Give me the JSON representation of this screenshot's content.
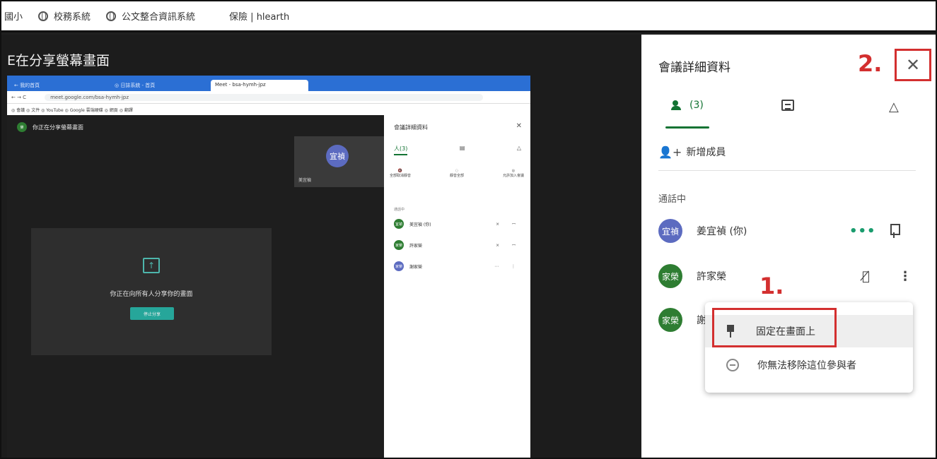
{
  "bookmarks": [
    "國小",
    "校務系統",
    "公文整合資訊系統",
    "保險 | hlearth"
  ],
  "stage": {
    "title": "E在分享螢幕畫面"
  },
  "nested": {
    "tabs": [
      "← 我的首頁",
      "◎ 日誌系統 - 首頁",
      "Meet - bsa-hymh-jpz"
    ],
    "url": "meet.google.com/bsa-hymh-jpz",
    "bookmark_bar": "◎ 會議 ◎ 文件 ◎ YouTube ◎ Google 雲端硬碟 ◎ 網頁 ◎ 翻譯",
    "presenting": "你正在分享螢幕畫面",
    "self_initials": "宜禎",
    "self_name": "美宜禎",
    "card_text": "你正在向所有人分享你的畫面",
    "stop_label": "停止分享",
    "panel_title": "會議詳細資料",
    "tab_people": "人(3)",
    "actions": [
      "全部取消靜音",
      "靜音全部",
      "允許加入會議"
    ],
    "section": "通話中",
    "rows": [
      {
        "initials": "宜禎",
        "name": "美宜禎 (你)"
      },
      {
        "initials": "家榮",
        "name": "許家榮"
      },
      {
        "initials": "家榮",
        "name": "謝家榮"
      }
    ]
  },
  "panel": {
    "title": "會議詳細資料",
    "step2": "2.",
    "close_glyph": "✕",
    "tab_people_count": "(3)",
    "add_member": "新增成員",
    "section": "通話中",
    "participants": [
      {
        "initials": "宜禎",
        "name": "姜宜禎 (你)",
        "color": "#5c6bc0"
      },
      {
        "initials": "家榮",
        "name": "許家榮",
        "color": "#2e7d32"
      },
      {
        "initials": "家榮",
        "name": "謝",
        "color": "#2e7d32"
      }
    ],
    "step1": "1.",
    "menu": {
      "pin_label": "固定在畫面上",
      "remove_label": "你無法移除這位參與者"
    }
  }
}
